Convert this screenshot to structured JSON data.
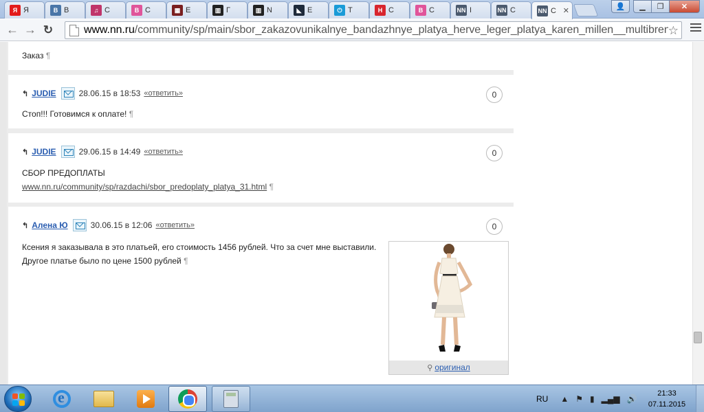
{
  "browser": {
    "tabs": [
      {
        "fav_text": "Я",
        "fav_color": "#e31b1b",
        "title": "Я"
      },
      {
        "fav_text": "B",
        "fav_color": "#4a76a8",
        "title": "B"
      },
      {
        "fav_text": "♫",
        "fav_color": "#c0356a",
        "title": "C"
      },
      {
        "fav_text": "B",
        "fav_color": "#e0559a",
        "title": "C"
      },
      {
        "fav_text": "▦",
        "fav_color": "#7a1f1f",
        "title": "E"
      },
      {
        "fav_text": "▥",
        "fav_color": "#222222",
        "title": "Г"
      },
      {
        "fav_text": "▥",
        "fav_color": "#222222",
        "title": "N"
      },
      {
        "fav_text": "◣",
        "fav_color": "#1e2a3a",
        "title": "E"
      },
      {
        "fav_text": "⏻",
        "fav_color": "#1a9bd7",
        "title": "T"
      },
      {
        "fav_text": "H",
        "fav_color": "#d8262e",
        "title": "C"
      },
      {
        "fav_text": "B",
        "fav_color": "#e0559a",
        "title": "C"
      },
      {
        "fav_text": "NN",
        "fav_color": "#4b5a6e",
        "title": "I"
      },
      {
        "fav_text": "NN",
        "fav_color": "#4b5a6e",
        "title": "C"
      },
      {
        "fav_text": "NN",
        "fav_color": "#4b5a6e",
        "title": "C"
      }
    ],
    "active_tab_index": 13,
    "url_host": "www.nn.ru",
    "url_path": "/community/sp/main/sbor_zakazovunikalnye_bandazhnye_platya_herve_leger_platya_karen_millen__multibrend"
  },
  "page": {
    "top_fragment": "Заказ",
    "pilcrow": "¶",
    "reply_arrow": "↰",
    "comments": [
      {
        "author": "JUDIE",
        "date": "28.06.15 в 18:53",
        "reply": "«ответить»",
        "count": "0",
        "text": "Стоп!!! Готовимся к оплате!"
      },
      {
        "author": "JUDIE",
        "date": "29.06.15 в 14:49",
        "reply": "«ответить»",
        "count": "0",
        "text": "СБОР ПРЕДОПЛАТЫ",
        "link": "www.nn.ru/community/sp/razdachi/sbor_predoplaty_platya_31.html"
      },
      {
        "author": "Алена Ю",
        "date": "30.06.15 в 12:06",
        "reply": "«ответить»",
        "count": "0",
        "text_line1": "Ксения я заказывала в это платьей, его стоимость 1456 рублей. Что за счет мне выставили.",
        "text_line2": "Другое платье было по цене 1500 рублей",
        "photo_caption": "оригинал"
      }
    ]
  },
  "taskbar": {
    "language": "RU",
    "time": "21:33",
    "date": "07.11.2015"
  }
}
